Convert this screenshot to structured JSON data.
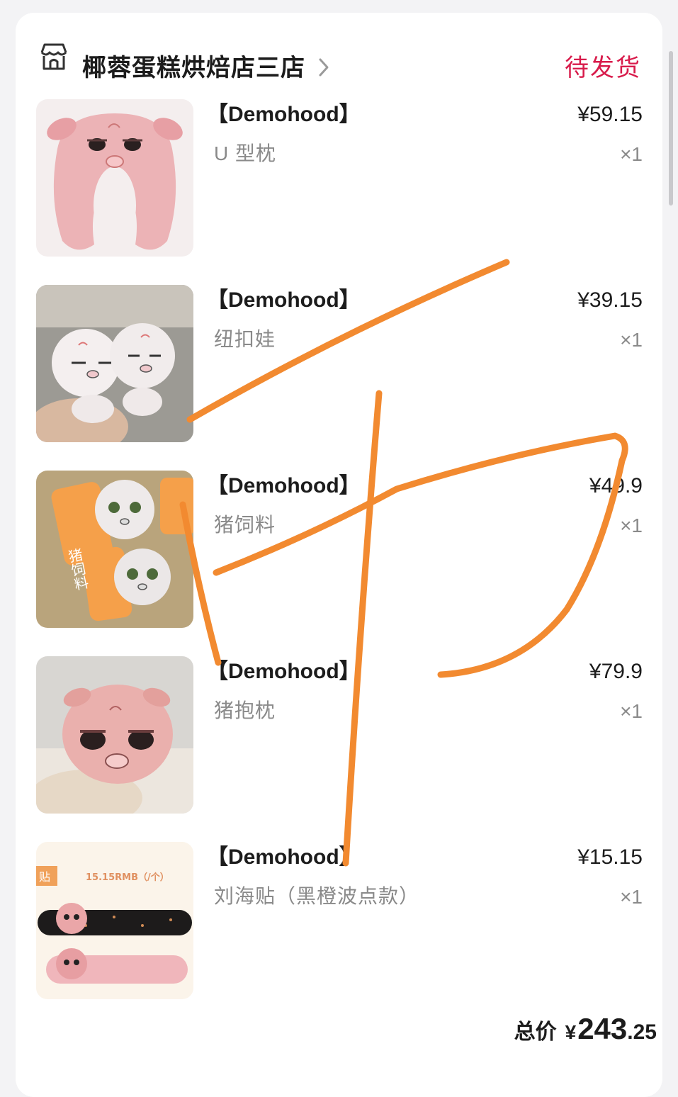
{
  "store": {
    "name": "椰蓉蛋糕烘焙店三店",
    "status": "待发货",
    "icon": "store-icon"
  },
  "items": [
    {
      "brand": "【Demohood】",
      "name": "U 型枕",
      "price": "¥59.15",
      "qty": "×1"
    },
    {
      "brand": "【Demohood】",
      "name": "纽扣娃",
      "price": "¥39.15",
      "qty": "×1"
    },
    {
      "brand": "【Demohood】",
      "name": "猪饲料",
      "price": "¥49.9",
      "qty": "×1"
    },
    {
      "brand": "【Demohood】",
      "name": "猪抱枕",
      "price": "¥79.9",
      "qty": "×1"
    },
    {
      "brand": "【Demohood】",
      "name": "刘海贴（黑橙波点款）",
      "price": "¥15.15",
      "qty": "×1"
    }
  ],
  "images": {
    "item2_tag": "猪饲料",
    "item4_banner": "15.15RMB（/个）",
    "item4_tag": "贴"
  },
  "total": {
    "label": "总价",
    "currency": "¥",
    "integer": "243",
    "decimal": ".25"
  },
  "colors": {
    "status": "#d81b4b",
    "annotation_stroke": "#f28a30",
    "card_background": "#ffffff",
    "page_background": "#f3f3f5"
  }
}
